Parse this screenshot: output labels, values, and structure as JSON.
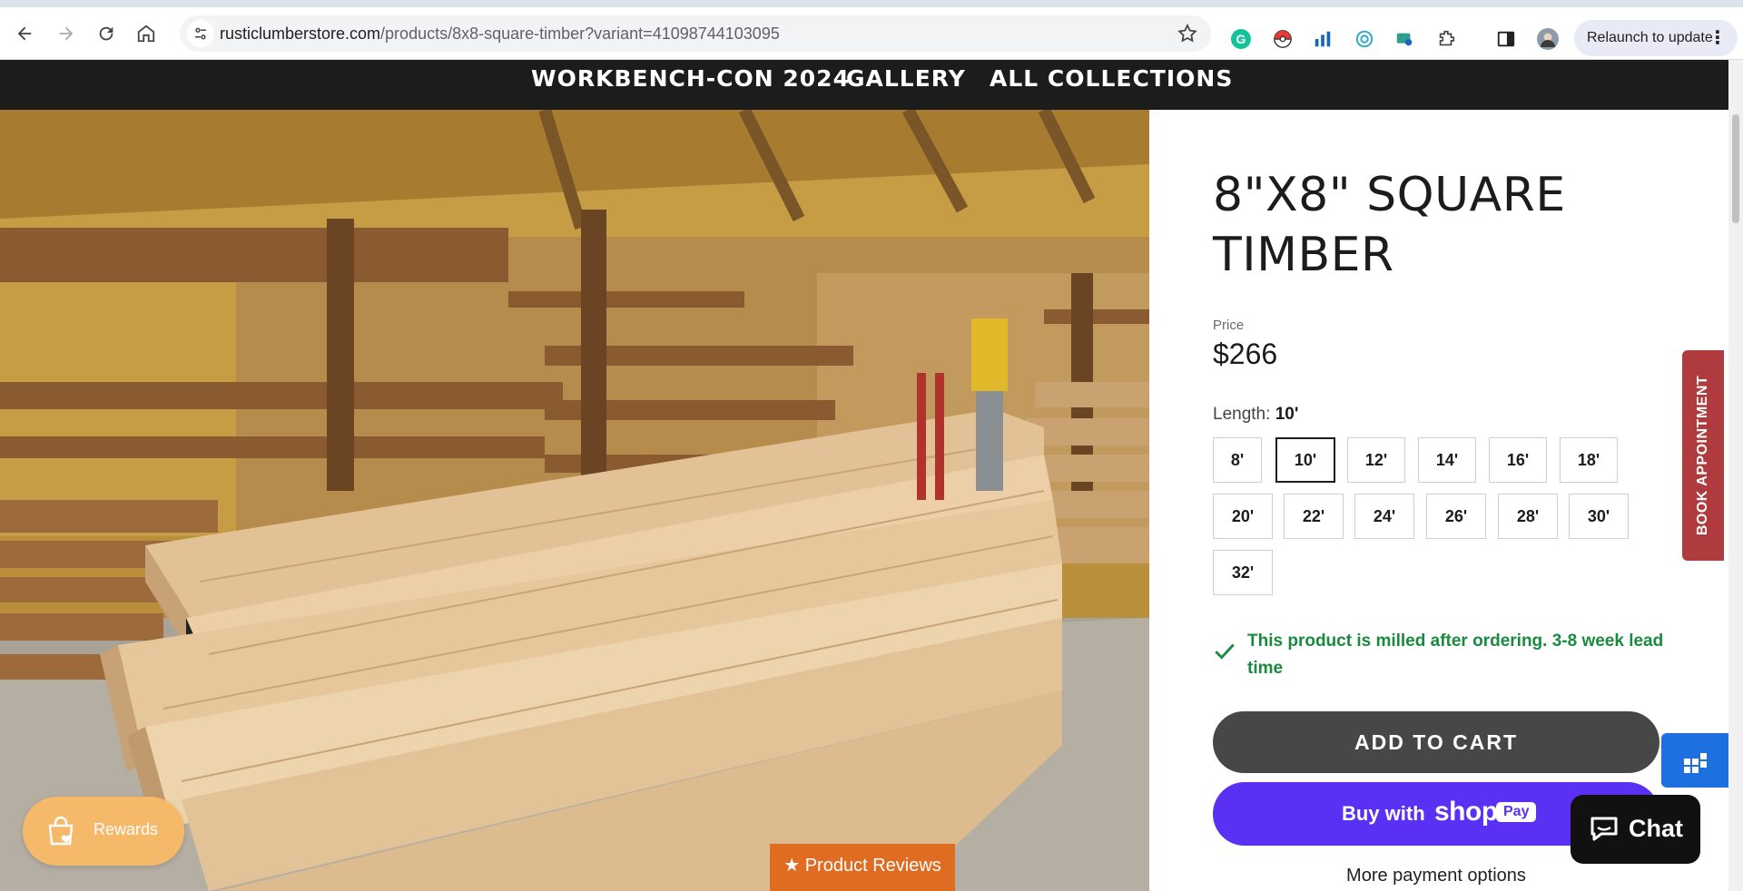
{
  "browser": {
    "url_host": "rusticlumberstore.com",
    "url_path": "/products/8x8-square-timber?variant=41098744103095",
    "relaunch_label": "Relaunch to update"
  },
  "nav": {
    "links": [
      "WORKBENCH-CON 2024",
      "GALLERY",
      "ALL COLLECTIONS"
    ]
  },
  "product": {
    "title": "8\"X8\" SQUARE TIMBER",
    "price_label": "Price",
    "price": "$266",
    "length_label": "Length:",
    "length_selected": "10'",
    "length_options": [
      "8'",
      "10'",
      "12'",
      "14'",
      "16'",
      "18'",
      "20'",
      "22'",
      "24'",
      "26'",
      "28'",
      "30'",
      "32'"
    ],
    "lead_time_notice": "This product is milled after ordering. 3-8 week lead time",
    "add_to_cart": "ADD TO CART",
    "buy_with": "Buy with",
    "shop_brand": "shop",
    "shop_pay": "Pay",
    "more_payment": "More payment options"
  },
  "widgets": {
    "reviews_tab": "★ Product Reviews",
    "rewards": "Rewards",
    "book_appointment": "BOOK APPOINTMENT",
    "chat": "Chat"
  },
  "colors": {
    "nav_bg": "#1c1c1c",
    "add_to_cart_bg": "#474747",
    "shop_pay_bg": "#5a31f4",
    "lead_time_green": "#1a8a3f",
    "book_bg": "#b03b3e",
    "reviews_bg": "#e06c21",
    "rewards_bg": "#f6b96a"
  }
}
